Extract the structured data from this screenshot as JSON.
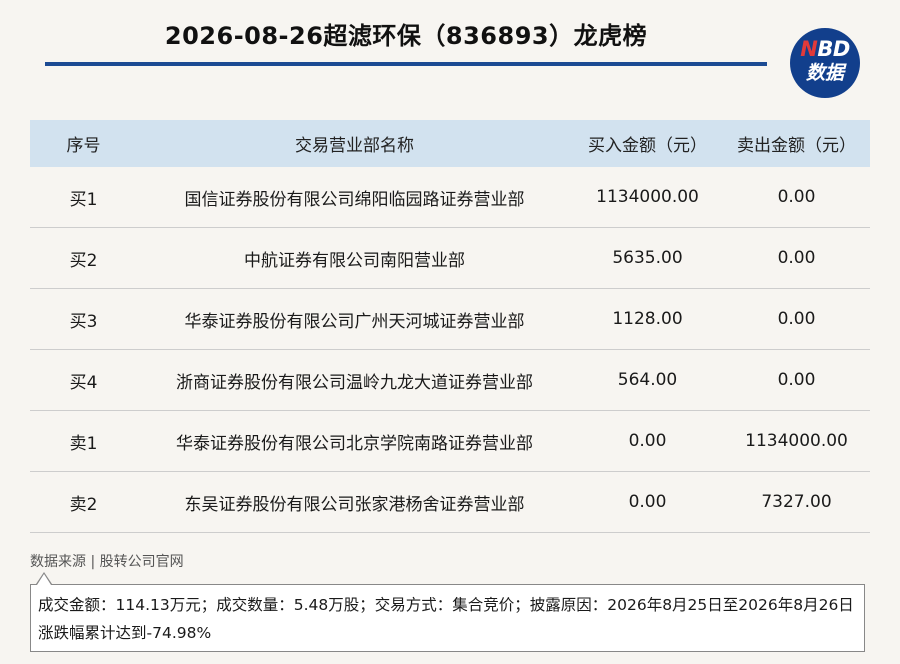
{
  "header": {
    "title": "2026-08-26超滤环保（836893）龙虎榜",
    "accent_color": "#1c4b93"
  },
  "logo": {
    "n": "N",
    "bd": "BD",
    "shuju": "数据",
    "bg_color": "#123f8c",
    "n_color": "#e23a3a"
  },
  "table": {
    "header_bg": "#d2e2ef",
    "columns": [
      "序号",
      "交易营业部名称",
      "买入金额（元）",
      "卖出金额（元）"
    ],
    "rows": [
      [
        "买1",
        "国信证券股份有限公司绵阳临园路证券营业部",
        "1134000.00",
        "0.00"
      ],
      [
        "买2",
        "中航证券有限公司南阳营业部",
        "5635.00",
        "0.00"
      ],
      [
        "买3",
        "华泰证券股份有限公司广州天河城证券营业部",
        "1128.00",
        "0.00"
      ],
      [
        "买4",
        "浙商证券股份有限公司温岭九龙大道证券营业部",
        "564.00",
        "0.00"
      ],
      [
        "卖1",
        "华泰证券股份有限公司北京学院南路证券营业部",
        "0.00",
        "1134000.00"
      ],
      [
        "卖2",
        "东吴证券股份有限公司张家港杨舍证券营业部",
        "0.00",
        "7327.00"
      ]
    ]
  },
  "footer": {
    "source": "数据来源 | 股转公司官网",
    "note_line1": "成交金额：114.13万元；成交数量：5.48万股；交易方式：集合竞价；披露原因：2026年8月25日至2026年8月26日",
    "note_line2": "涨跌幅累计达到-74.98%"
  }
}
